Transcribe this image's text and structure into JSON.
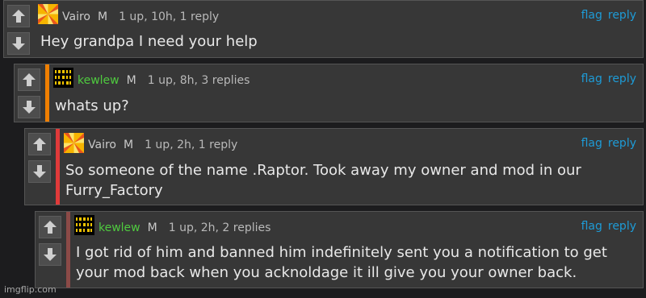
{
  "colors": {
    "link": "#1e9bd6",
    "username_default": "#c9c9c9",
    "username_green": "#4fca3f",
    "stripe_orange": "#f07f00",
    "stripe_red": "#e03a3a",
    "stripe_brown": "#8b4a47"
  },
  "comments": [
    {
      "username": "Vairo",
      "mod": "M",
      "meta": "1 up, 10h, 1 reply",
      "flag": "flag",
      "reply": "reply",
      "text": "Hey grandpa I need your help",
      "avatar": "pinwheel-icon"
    },
    {
      "username": "kewlew",
      "mod": "M",
      "meta": "1 up, 8h, 3 replies",
      "flag": "flag",
      "reply": "reply",
      "text": "whats up?",
      "avatar": "binary-icon"
    },
    {
      "username": "Vairo",
      "mod": "M",
      "meta": "1 up, 2h, 1 reply",
      "flag": "flag",
      "reply": "reply",
      "text": "So someone of the name .Raptor. Took away my owner and mod in our Furry_Factory",
      "avatar": "pinwheel-icon"
    },
    {
      "username": "kewlew",
      "mod": "M",
      "meta": "1 up, 2h, 2 replies",
      "flag": "flag",
      "reply": "reply",
      "text": "I got rid of him and banned him indefinitely sent you a notification to get your mod back when you acknoldage it ill give you your owner back.",
      "avatar": "binary-icon"
    }
  ],
  "watermark": "imgflip.com"
}
